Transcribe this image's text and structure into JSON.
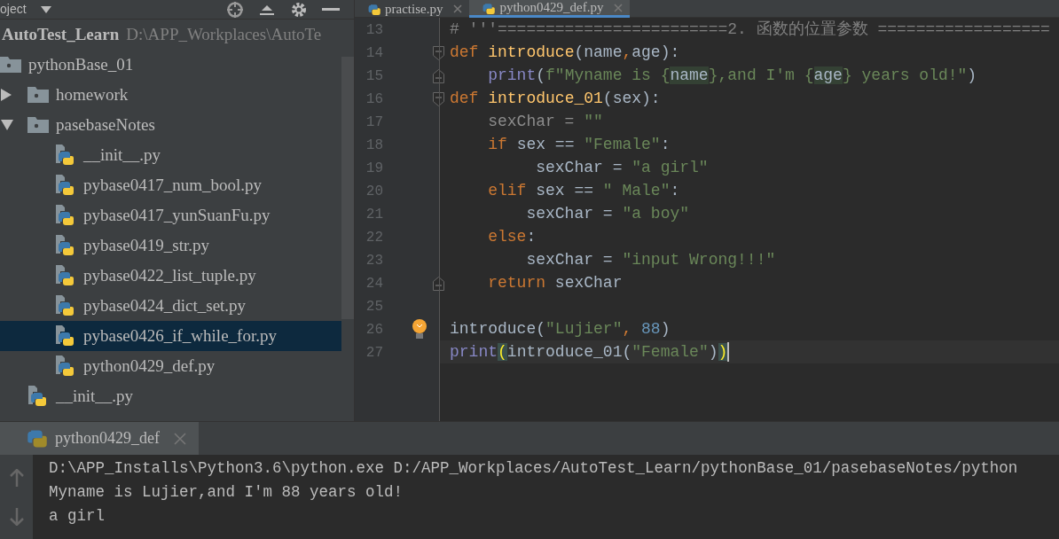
{
  "project_panel": {
    "title": "oject",
    "root": {
      "name": "AutoTest_Learn",
      "path": "D:\\APP_Workplaces\\AutoTe",
      "children": [
        {
          "name": "pythonBase_01",
          "kind": "folder",
          "selected": false,
          "children": [
            {
              "name": "homework",
              "kind": "folder",
              "expanded": false,
              "selected": false
            },
            {
              "name": "pasebaseNotes",
              "kind": "folder",
              "expanded": true,
              "selected": false,
              "children": [
                {
                  "name": "__init__.py",
                  "kind": "file",
                  "selected": false
                },
                {
                  "name": "pybase0417_num_bool.py",
                  "kind": "file",
                  "selected": false
                },
                {
                  "name": "pybase0417_yunSuanFu.py",
                  "kind": "file",
                  "selected": false
                },
                {
                  "name": "pybase0419_str.py",
                  "kind": "file",
                  "selected": false
                },
                {
                  "name": "pybase0422_list_tuple.py",
                  "kind": "file",
                  "selected": false
                },
                {
                  "name": "pybase0424_dict_set.py",
                  "kind": "file",
                  "selected": false
                },
                {
                  "name": "pybase0426_if_while_for.py",
                  "kind": "file",
                  "selected": true
                },
                {
                  "name": "python0429_def.py",
                  "kind": "file",
                  "selected": false
                }
              ]
            },
            {
              "name": "__init__.py",
              "kind": "file",
              "selected": false
            }
          ]
        }
      ]
    }
  },
  "editor": {
    "tabs": [
      {
        "label": "practise.py",
        "selected": false
      },
      {
        "label": "python0429_def.py",
        "selected": true
      }
    ],
    "lines": [
      {
        "number": "13",
        "current": false,
        "tokens": [
          {
            "kind": "comment",
            "text": "# '''========================2. 函数的位置参数 =================="
          }
        ]
      },
      {
        "number": "14",
        "current": false,
        "fold_start": true,
        "tokens": [
          {
            "kind": "keyword",
            "text": "def "
          },
          {
            "kind": "function",
            "text": "introduce"
          },
          {
            "kind": "plain",
            "text": "(name"
          },
          {
            "kind": "keyword",
            "text": ","
          },
          {
            "kind": "plain",
            "text": "age):"
          }
        ]
      },
      {
        "number": "15",
        "current": false,
        "fold_end": true,
        "tokens": [
          {
            "kind": "builtin",
            "text": "    print"
          },
          {
            "kind": "plain",
            "text": "("
          },
          {
            "kind": "string",
            "text": "f\"Myname is {"
          },
          {
            "kind": "injected",
            "text": "name"
          },
          {
            "kind": "string",
            "text": "},and I'm {"
          },
          {
            "kind": "injected",
            "text": "age"
          },
          {
            "kind": "string",
            "text": "} years old!\""
          },
          {
            "kind": "plain",
            "text": ")"
          }
        ]
      },
      {
        "number": "16",
        "current": false,
        "fold_start": true,
        "tokens": [
          {
            "kind": "keyword",
            "text": "def "
          },
          {
            "kind": "function",
            "text": "introduce_01"
          },
          {
            "kind": "plain",
            "text": "(sex):"
          }
        ]
      },
      {
        "number": "17",
        "current": false,
        "tokens": [
          {
            "kind": "unused",
            "text": "    sexChar = "
          },
          {
            "kind": "string",
            "text": "\"\""
          }
        ]
      },
      {
        "number": "18",
        "current": false,
        "tokens": [
          {
            "kind": "keyword",
            "text": "    if "
          },
          {
            "kind": "plain",
            "text": "sex == "
          },
          {
            "kind": "string",
            "text": "\"Female\""
          },
          {
            "kind": "plain",
            "text": ":"
          }
        ]
      },
      {
        "number": "19",
        "current": false,
        "tokens": [
          {
            "kind": "plain",
            "text": "         sexChar = "
          },
          {
            "kind": "string",
            "text": "\"a girl\""
          }
        ]
      },
      {
        "number": "20",
        "current": false,
        "tokens": [
          {
            "kind": "keyword",
            "text": "    elif "
          },
          {
            "kind": "plain",
            "text": "sex == "
          },
          {
            "kind": "string",
            "text": "\" Male\""
          },
          {
            "kind": "plain",
            "text": ":"
          }
        ]
      },
      {
        "number": "21",
        "current": false,
        "tokens": [
          {
            "kind": "plain",
            "text": "        sexChar = "
          },
          {
            "kind": "string",
            "text": "\"a boy\""
          }
        ]
      },
      {
        "number": "22",
        "current": false,
        "tokens": [
          {
            "kind": "keyword",
            "text": "    else"
          },
          {
            "kind": "plain",
            "text": ":"
          }
        ]
      },
      {
        "number": "23",
        "current": false,
        "tokens": [
          {
            "kind": "plain",
            "text": "        sexChar = "
          },
          {
            "kind": "string",
            "text": "\"input Wrong!!!\""
          }
        ]
      },
      {
        "number": "24",
        "current": false,
        "fold_end": true,
        "tokens": [
          {
            "kind": "keyword",
            "text": "    return "
          },
          {
            "kind": "plain",
            "text": "sexChar"
          }
        ]
      },
      {
        "number": "25",
        "current": false
      },
      {
        "number": "26",
        "current": false,
        "hint": true,
        "tokens": [
          {
            "kind": "plain",
            "text": "introduce("
          },
          {
            "kind": "string",
            "text": "\"Lujier\""
          },
          {
            "kind": "keyword",
            "text": ","
          },
          {
            "kind": "number",
            "text": " 88"
          },
          {
            "kind": "plain",
            "text": ")"
          }
        ]
      },
      {
        "number": "27",
        "current": true,
        "tokens": [
          {
            "kind": "builtin",
            "text": "print"
          },
          {
            "kind": "brace",
            "text": "("
          },
          {
            "kind": "plain",
            "text": "introduce_01("
          },
          {
            "kind": "string",
            "text": "\"Female\""
          },
          {
            "kind": "plain",
            "text": ")"
          },
          {
            "kind": "brace",
            "text": ")"
          }
        ]
      }
    ]
  },
  "run_panel": {
    "tab": {
      "label": "python0429_def",
      "selected": true
    },
    "output": [
      "D:\\APP_Installs\\Python3.6\\python.exe D:/APP_Workplaces/AutoTest_Learn/pythonBase_01/pasebaseNotes/python",
      "Myname is Lujier,and I'm 88 years old!",
      "a girl"
    ]
  }
}
